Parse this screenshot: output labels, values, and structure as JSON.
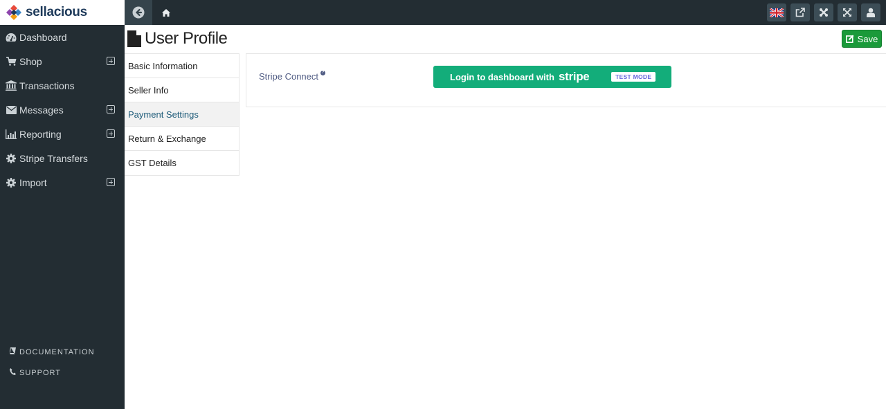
{
  "app": {
    "brand": "sellacious"
  },
  "topbar": {
    "back_icon": "arrow-circle-left-icon",
    "home_icon": "home-icon",
    "right_icons": [
      "uk-flag-icon",
      "external-link-icon",
      "joomla-icon",
      "expand-icon",
      "user-icon"
    ]
  },
  "sidebar": {
    "items": [
      {
        "label": "Dashboard",
        "icon": "dashboard-icon",
        "expandable": false
      },
      {
        "label": "Shop",
        "icon": "cart-icon",
        "expandable": true
      },
      {
        "label": "Transactions",
        "icon": "bank-icon",
        "expandable": false
      },
      {
        "label": "Messages",
        "icon": "envelope-icon",
        "expandable": true
      },
      {
        "label": "Reporting",
        "icon": "bar-chart-icon",
        "expandable": true
      },
      {
        "label": "Stripe Transfers",
        "icon": "gear-icon",
        "expandable": false
      },
      {
        "label": "Import",
        "icon": "gear-icon",
        "expandable": true
      }
    ],
    "footer": {
      "documentation": "DOCUMENTATION",
      "support": "SUPPORT"
    }
  },
  "page": {
    "title": "User Profile",
    "save_label": "Save"
  },
  "tabs": [
    {
      "label": "Basic Information",
      "active": false
    },
    {
      "label": "Seller Info",
      "active": false
    },
    {
      "label": "Payment Settings",
      "active": true
    },
    {
      "label": "Return & Exchange",
      "active": false
    },
    {
      "label": "GST Details",
      "active": false
    }
  ],
  "payment": {
    "field_label": "Stripe Connect",
    "help_glyph": "?",
    "button_label": "Login to dashboard with",
    "button_brand": "stripe",
    "badge": "TEST MODE",
    "button_color": "#13ad7a"
  }
}
